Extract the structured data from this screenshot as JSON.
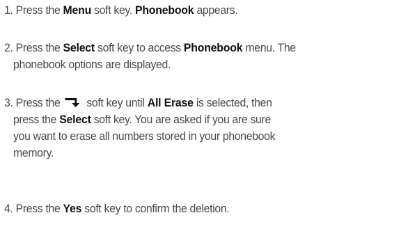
{
  "steps": [
    {
      "lines": [
        [
          {
            "t": "1. Press the ",
            "b": false
          },
          {
            "t": "Menu",
            "b": true
          },
          {
            "t": " soft key. ",
            "b": false
          },
          {
            "t": "Phonebook",
            "b": true
          },
          {
            "t": " appears.",
            "b": false
          }
        ]
      ]
    },
    {
      "lines": [
        [
          {
            "t": "2. Press the ",
            "b": false
          },
          {
            "t": "Select",
            "b": true
          },
          {
            "t": " soft key to access ",
            "b": false
          },
          {
            "t": "Phonebook",
            "b": true
          },
          {
            "t": " menu. The",
            "b": false
          }
        ],
        [
          {
            "t": "phonebook options are displayed.",
            "b": false
          }
        ]
      ]
    },
    {
      "lines": [
        [
          {
            "t": "3. Press the ",
            "b": false
          },
          {
            "icon": "down-soft-key-icon"
          },
          {
            "t": " soft key until ",
            "b": false
          },
          {
            "t": "All Erase",
            "b": true
          },
          {
            "t": " is selected, then",
            "b": false
          }
        ],
        [
          {
            "t": "press the ",
            "b": false
          },
          {
            "t": "Select",
            "b": true
          },
          {
            "t": " soft key. You are asked if you are sure",
            "b": false
          }
        ],
        [
          {
            "t": "you want to erase all numbers stored in your phonebook",
            "b": false
          }
        ],
        [
          {
            "t": "memory.",
            "b": false
          }
        ]
      ]
    },
    {
      "lines": [
        [
          {
            "t": "4. Press the ",
            "b": false
          },
          {
            "t": "Yes",
            "b": true
          },
          {
            "t": " soft key to confirm the deletion.",
            "b": false
          }
        ]
      ]
    }
  ]
}
